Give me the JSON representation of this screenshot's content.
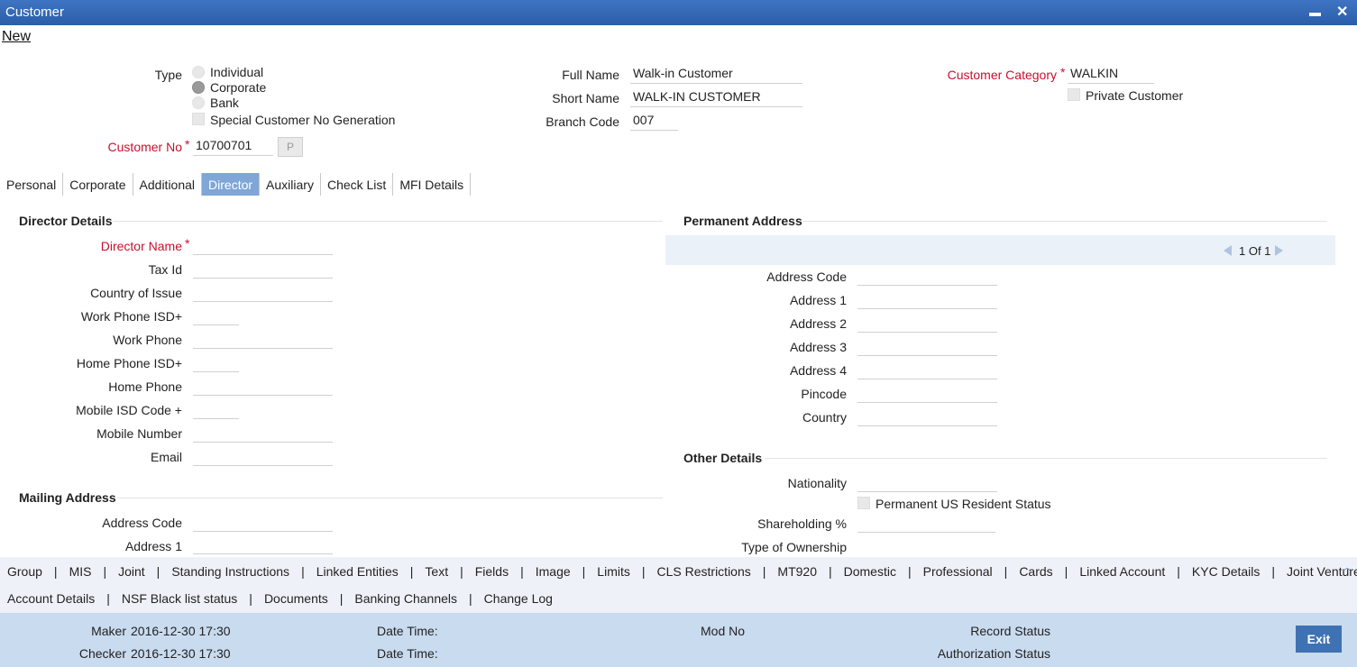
{
  "window": {
    "title": "Customer",
    "minimize_icon": "minimize-icon",
    "close_icon": "close-icon",
    "minimize_glyph": "▬",
    "close_glyph": "✕"
  },
  "toolbar": {
    "new_label": "New"
  },
  "header": {
    "type_label": "Type",
    "type_options": [
      {
        "label": "Individual",
        "selected": false
      },
      {
        "label": "Corporate",
        "selected": true
      },
      {
        "label": "Bank",
        "selected": false
      }
    ],
    "special_no_gen_label": "Special Customer No Generation",
    "customer_no_label": "Customer No",
    "required_mark": "*",
    "customer_no_value": "10700701",
    "p_button_label": "P",
    "full_name_label": "Full Name",
    "full_name_value": "Walk-in Customer",
    "short_name_label": "Short Name",
    "short_name_value": "WALK-IN CUSTOMER",
    "branch_code_label": "Branch Code",
    "branch_code_value": "007",
    "customer_category_label": "Customer Category",
    "customer_category_value": "WALKIN",
    "private_customer_label": "Private Customer"
  },
  "tabs": [
    {
      "label": "Personal",
      "active": false
    },
    {
      "label": "Corporate",
      "active": false
    },
    {
      "label": "Additional",
      "active": false
    },
    {
      "label": "Director",
      "active": true
    },
    {
      "label": "Auxiliary",
      "active": false
    },
    {
      "label": "Check List",
      "active": false
    },
    {
      "label": "MFI Details",
      "active": false
    }
  ],
  "director": {
    "section_title": "Director Details",
    "fields": [
      {
        "label": "Director Name",
        "required": true,
        "value": ""
      },
      {
        "label": "Tax Id",
        "value": ""
      },
      {
        "label": "Country of Issue",
        "value": ""
      },
      {
        "label": "Work Phone ISD+",
        "value": "",
        "short": true
      },
      {
        "label": "Work Phone",
        "value": ""
      },
      {
        "label": "Home Phone ISD+",
        "value": "",
        "short": true
      },
      {
        "label": "Home Phone",
        "value": ""
      },
      {
        "label": "Mobile ISD Code +",
        "value": "",
        "short": true
      },
      {
        "label": "Mobile Number",
        "value": ""
      },
      {
        "label": "Email",
        "value": ""
      }
    ]
  },
  "mailing": {
    "section_title": "Mailing Address",
    "fields": [
      {
        "label": "Address Code",
        "value": ""
      },
      {
        "label": "Address 1",
        "value": ""
      }
    ]
  },
  "permanent": {
    "section_title": "Permanent Address",
    "pager": "1 Of 1",
    "fields": [
      {
        "label": "Address Code",
        "value": ""
      },
      {
        "label": "Address 1",
        "value": ""
      },
      {
        "label": "Address 2",
        "value": ""
      },
      {
        "label": "Address 3",
        "value": ""
      },
      {
        "label": "Address 4",
        "value": ""
      },
      {
        "label": "Pincode",
        "value": ""
      },
      {
        "label": "Country",
        "value": ""
      }
    ]
  },
  "other": {
    "section_title": "Other Details",
    "nationality_label": "Nationality",
    "nationality_value": "",
    "us_resident_label": "Permanent US Resident Status",
    "shareholding_label": "Shareholding %",
    "shareholding_value": "",
    "ownership_label": "Type of Ownership"
  },
  "bottom_links": {
    "row1": [
      "Group",
      "MIS",
      "Joint",
      "Standing Instructions",
      "Linked Entities",
      "Text",
      "Fields",
      "Image",
      "Limits",
      "CLS Restrictions",
      "MT920",
      "Domestic",
      "Professional",
      "Cards",
      "Linked Account",
      "KYC Details",
      "Joint Venture"
    ],
    "row2": [
      "Account Details",
      "NSF Black list status",
      "Documents",
      "Banking Channels",
      "Change Log"
    ],
    "separator": "|"
  },
  "footer": {
    "maker_label": "Maker",
    "maker_value": "2016-12-30 17:30",
    "checker_label": "Checker",
    "checker_value": "2016-12-30 17:30",
    "date_time_label": "Date Time:",
    "mod_no_label": "Mod No",
    "record_status_label": "Record Status",
    "auth_status_label": "Authorization Status",
    "exit_label": "Exit"
  },
  "colors": {
    "title_bar": "#2f63ae",
    "active_tab": "#7fa6d6",
    "footer": "#c9dbef",
    "required": "#c8102e",
    "exit_button": "#3f72b3"
  }
}
